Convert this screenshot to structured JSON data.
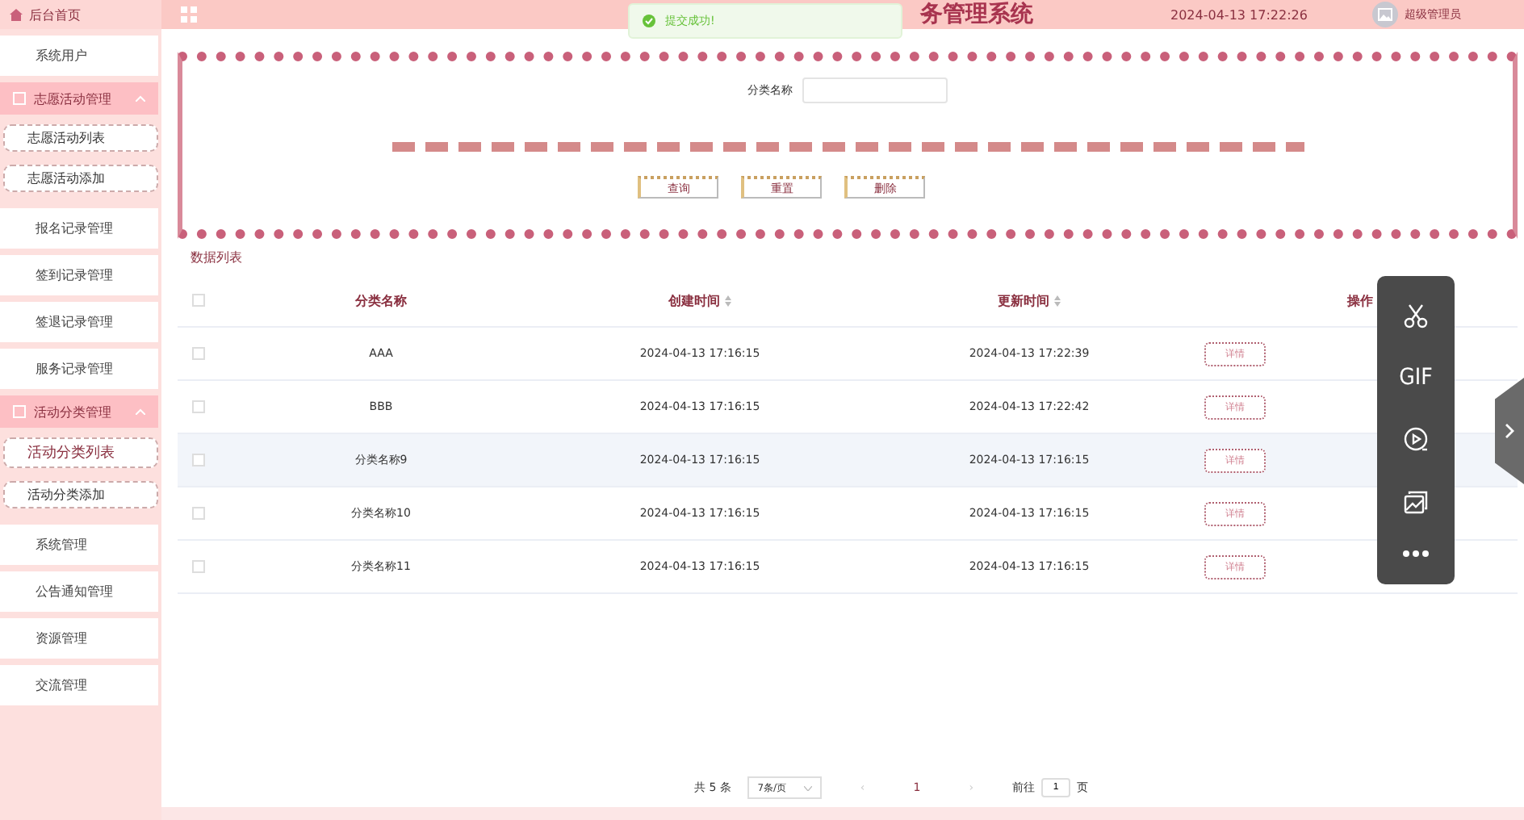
{
  "header": {
    "home": "后台首页",
    "title": "务管理系统",
    "datetime": "2024-04-13 17:22:26",
    "user": "超级管理员"
  },
  "toast": {
    "kind": "success",
    "text": "提交成功!"
  },
  "sidebar": {
    "items": [
      {
        "kind": "link",
        "label": "系统用户"
      },
      {
        "kind": "group",
        "label": "志愿活动管理",
        "expanded": true,
        "children": [
          {
            "label": "志愿活动列表",
            "selected": false
          },
          {
            "label": "志愿活动添加",
            "selected": false
          }
        ]
      },
      {
        "kind": "link",
        "label": "报名记录管理"
      },
      {
        "kind": "link",
        "label": "签到记录管理"
      },
      {
        "kind": "link",
        "label": "签退记录管理"
      },
      {
        "kind": "link",
        "label": "服务记录管理"
      },
      {
        "kind": "group",
        "label": "活动分类管理",
        "expanded": true,
        "children": [
          {
            "label": "活动分类列表",
            "selected": true
          },
          {
            "label": "活动分类添加",
            "selected": false
          }
        ]
      },
      {
        "kind": "link",
        "label": "系统管理"
      },
      {
        "kind": "link",
        "label": "公告通知管理"
      },
      {
        "kind": "link",
        "label": "资源管理"
      },
      {
        "kind": "link",
        "label": "交流管理"
      }
    ]
  },
  "search": {
    "label": "分类名称",
    "buttons": [
      "查询",
      "重置",
      "删除"
    ]
  },
  "table": {
    "title": "数据列表",
    "all_checked": false,
    "columns": [
      {
        "label": "分类名称",
        "sortable": false
      },
      {
        "label": "创建时间",
        "sortable": true
      },
      {
        "label": "更新时间",
        "sortable": true
      },
      {
        "label": "操作",
        "sortable": false
      }
    ],
    "rows": [
      {
        "name": "AAA",
        "created": "2024-04-13 17:16:15",
        "updated": "2024-04-13 17:22:39",
        "action": "详情",
        "checked": false,
        "hovered": false
      },
      {
        "name": "BBB",
        "created": "2024-04-13 17:16:15",
        "updated": "2024-04-13 17:22:42",
        "action": "详情",
        "checked": false,
        "hovered": false
      },
      {
        "name": "分类名称9",
        "created": "2024-04-13 17:16:15",
        "updated": "2024-04-13 17:16:15",
        "action": "详情",
        "checked": false,
        "hovered": true
      },
      {
        "name": "分类名称10",
        "created": "2024-04-13 17:16:15",
        "updated": "2024-04-13 17:16:15",
        "action": "详情",
        "checked": false,
        "hovered": false
      },
      {
        "name": "分类名称11",
        "created": "2024-04-13 17:16:15",
        "updated": "2024-04-13 17:16:15",
        "action": "详情",
        "checked": false,
        "hovered": false
      }
    ]
  },
  "pagination": {
    "total": "共 5 条",
    "page_size": "7条/页",
    "prev": "‹",
    "current": "1",
    "next": "›",
    "goto_label": "前往",
    "goto_value": "1",
    "goto_suffix": "页"
  },
  "capture_toolbar": {
    "tools": [
      {
        "kind": "scissors"
      },
      {
        "kind": "gif",
        "label": "GIF"
      },
      {
        "kind": "record"
      },
      {
        "kind": "image"
      },
      {
        "kind": "more"
      }
    ]
  }
}
